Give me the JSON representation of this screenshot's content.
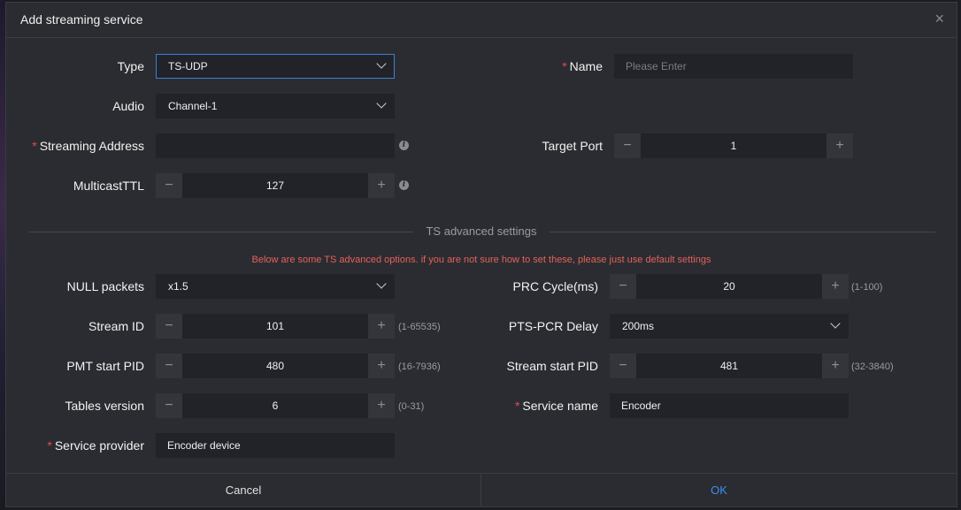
{
  "dialog": {
    "title": "Add streaming service",
    "close_symbol": "×"
  },
  "fields": {
    "type": {
      "label": "Type",
      "value": "TS-UDP"
    },
    "name": {
      "label": "Name",
      "placeholder": "Please Enter",
      "required_mark": "*"
    },
    "audio": {
      "label": "Audio",
      "value": "Channel-1"
    },
    "streaming_address": {
      "label": "Streaming Address",
      "value": "",
      "required_mark": "*",
      "info_symbol": "i"
    },
    "target_port": {
      "label": "Target Port",
      "value": "1"
    },
    "multicast_ttl": {
      "label": "MulticastTTL",
      "value": "127",
      "info_symbol": "i"
    }
  },
  "advanced": {
    "section_title": "TS advanced settings",
    "warning": "Below are some TS advanced options. if you are not sure how to set these, please just use default settings",
    "null_packets": {
      "label": "NULL packets",
      "value": "x1.5"
    },
    "prc_cycle": {
      "label": "PRC Cycle(ms)",
      "value": "20",
      "range": "(1-100)"
    },
    "stream_id": {
      "label": "Stream ID",
      "value": "101",
      "range": "(1-65535)"
    },
    "pts_pcr_delay": {
      "label": "PTS-PCR Delay",
      "value": "200ms"
    },
    "pmt_start_pid": {
      "label": "PMT start PID",
      "value": "480",
      "range": "(16-7936)"
    },
    "stream_start_pid": {
      "label": "Stream start PID",
      "value": "481",
      "range": "(32-3840)"
    },
    "tables_version": {
      "label": "Tables version",
      "value": "6",
      "range": "(0-31)"
    },
    "service_name": {
      "label": "Service name",
      "value": "Encoder",
      "required_mark": "*"
    },
    "service_provider": {
      "label": "Service provider",
      "value": "Encoder device",
      "required_mark": "*"
    }
  },
  "stepper_symbols": {
    "minus": "−",
    "plus": "+"
  },
  "footer": {
    "cancel_label": "Cancel",
    "ok_label": "OK"
  },
  "colors": {
    "accent": "#3b8ff0",
    "required": "#e54b4b",
    "warning": "#e4615a",
    "dialog_bg": "#2b2c31",
    "field_bg": "#222329"
  }
}
